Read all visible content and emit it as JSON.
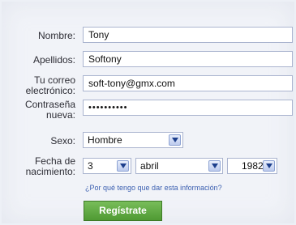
{
  "form": {
    "name": {
      "label": "Nombre:",
      "value": "Tony"
    },
    "surname": {
      "label": "Apellidos:",
      "value": "Softony"
    },
    "email": {
      "label_line1": "Tu correo",
      "label_line2": "electrónico:",
      "value": "soft-tony@gmx.com"
    },
    "password": {
      "label_line1": "Contraseña",
      "label_line2": "nueva:",
      "value": "••••••••••"
    },
    "sex": {
      "label": "Sexo:",
      "value": "Hombre"
    },
    "birth": {
      "label_line1": "Fecha de",
      "label_line2": "nacimiento:",
      "day": "3",
      "month": "abril",
      "year": "1982"
    },
    "why_link": "¿Por qué tengo que dar esta información?",
    "submit_label": "Regístrate"
  },
  "colors": {
    "button_green": "#5ea63f",
    "field_border": "#aab4cf",
    "link_blue": "#3b5fb0"
  }
}
